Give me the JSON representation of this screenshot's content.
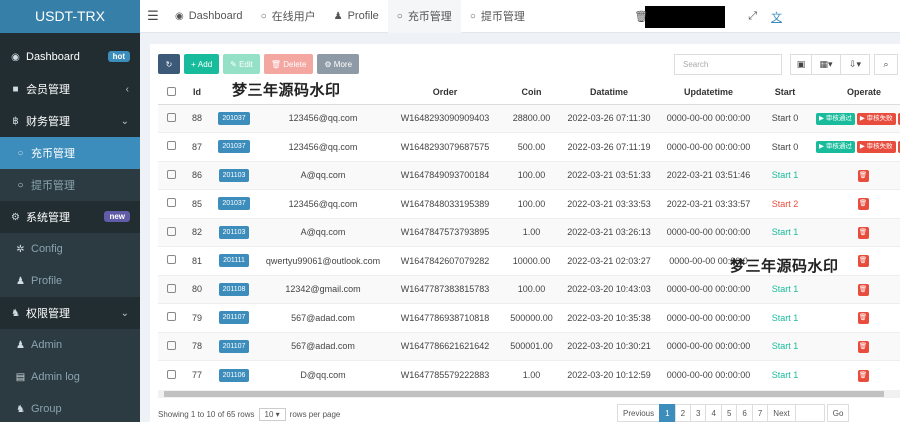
{
  "brand": "USDT-TRX",
  "sidebar": {
    "items": [
      {
        "label": "Dashboard",
        "icon": "dashboard-icon",
        "badge": "hot"
      },
      {
        "label": "会员管理",
        "icon": "member-icon"
      },
      {
        "label": "财务管理",
        "icon": "finance-icon"
      },
      {
        "label": "充币管理"
      },
      {
        "label": "提币管理"
      },
      {
        "label": "系统管理",
        "icon": "gears-icon",
        "badge": "new"
      },
      {
        "label": "Config",
        "icon": "gear-icon"
      },
      {
        "label": "Profile",
        "icon": "user-icon"
      },
      {
        "label": "权限管理",
        "icon": "group-icon"
      },
      {
        "label": "Admin",
        "icon": "user-icon"
      },
      {
        "label": "Admin log",
        "icon": "list-icon"
      },
      {
        "label": "Group",
        "icon": "group-icon"
      }
    ]
  },
  "topnav": {
    "tabs": [
      "Dashboard",
      "在线用户",
      "Profile",
      "充币管理",
      "提币管理"
    ]
  },
  "toolbar": {
    "add": "Add",
    "edit": "Edit",
    "delete": "Delete",
    "more": "More",
    "search_placeholder": "Search"
  },
  "table": {
    "columns": [
      "Id",
      "Order",
      "Coin",
      "Datatime",
      "Updatetime",
      "Start",
      "Operate"
    ],
    "rows": [
      {
        "id": "88",
        "uid": "201037",
        "email": "123456@qq.com",
        "order": "W1648293090909403",
        "coin": "28800.00",
        "datatime": "2022-03-26 07:11:30",
        "updatetime": "0000-00-00 00:00:00",
        "start": "Start 0"
      },
      {
        "id": "87",
        "uid": "201037",
        "email": "123456@qq.com",
        "order": "W1648293079687575",
        "coin": "500.00",
        "datatime": "2022-03-26 07:11:19",
        "updatetime": "0000-00-00 00:00:00",
        "start": "Start 0"
      },
      {
        "id": "86",
        "uid": "201103",
        "email": "A@qq.com",
        "order": "W1647849093700184",
        "coin": "100.00",
        "datatime": "2022-03-21 03:51:33",
        "updatetime": "2022-03-21 03:51:46",
        "start": "Start 1"
      },
      {
        "id": "85",
        "uid": "201037",
        "email": "123456@qq.com",
        "order": "W1647848033195389",
        "coin": "100.00",
        "datatime": "2022-03-21 03:33:53",
        "updatetime": "2022-03-21 03:33:57",
        "start": "Start 2"
      },
      {
        "id": "82",
        "uid": "201103",
        "email": "A@qq.com",
        "order": "W1647847573793895",
        "coin": "1.00",
        "datatime": "2022-03-21 03:26:13",
        "updatetime": "0000-00-00 00:00:00",
        "start": "Start 1"
      },
      {
        "id": "81",
        "uid": "201111",
        "email": "qwertyu99061@outlook.com",
        "order": "W1647842607079282",
        "coin": "10000.00",
        "datatime": "2022-03-21 02:03:27",
        "updatetime": "0000-00-00 00:00:0",
        "start": ""
      },
      {
        "id": "80",
        "uid": "201108",
        "email": "12342@gmail.com",
        "order": "W1647787383815783",
        "coin": "100.00",
        "datatime": "2022-03-20 10:43:03",
        "updatetime": "0000-00-00 00:00:00",
        "start": "Start 1"
      },
      {
        "id": "79",
        "uid": "201107",
        "email": "567@adad.com",
        "order": "W1647786938710818",
        "coin": "500000.00",
        "datatime": "2022-03-20 10:35:38",
        "updatetime": "0000-00-00 00:00:00",
        "start": "Start 1"
      },
      {
        "id": "78",
        "uid": "201107",
        "email": "567@adad.com",
        "order": "W1647786621621642",
        "coin": "500001.00",
        "datatime": "2022-03-20 10:30:21",
        "updatetime": "0000-00-00 00:00:00",
        "start": "Start 1"
      },
      {
        "id": "77",
        "uid": "201106",
        "email": "D@qq.com",
        "order": "W1647785579222883",
        "coin": "1.00",
        "datatime": "2022-03-20 10:12:59",
        "updatetime": "0000-00-00 00:00:00",
        "start": "Start 1"
      }
    ],
    "approve_label": "审核通过",
    "reject_label": "审核失败"
  },
  "watermark": "梦三年源码水印",
  "footer": {
    "showing": "Showing 1 to 10 of 65 rows",
    "page_size": "10",
    "rows_per_page": "rows per page"
  },
  "pager": [
    "Previous",
    "1",
    "2",
    "3",
    "4",
    "5",
    "6",
    "7",
    "Next",
    "",
    "Go"
  ],
  "colors": {
    "primary": "#3c8dbc",
    "success": "#18bc9c",
    "danger": "#e74c3c",
    "sidebar": "#222d32"
  }
}
